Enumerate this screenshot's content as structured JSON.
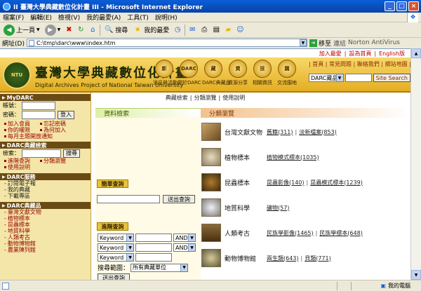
{
  "window": {
    "title": "II 臺灣大學典藏數位化計畫 III - Microsoft Internet Explorer",
    "min": "_",
    "max": "□",
    "close": "×"
  },
  "menu": [
    "檔案(F)",
    "編輯(E)",
    "檢視(V)",
    "我的最愛(A)",
    "工具(T)",
    "說明(H)"
  ],
  "toolbar": {
    "back": "上一頁",
    "search": "搜尋",
    "favorites": "我的最愛"
  },
  "address": {
    "label": "網址(D)",
    "url": "C:\\tmp\\darc\\www\\index.htm",
    "go": "移至",
    "links": "連結",
    "extra": "Norton AntiVirus"
  },
  "status": {
    "zone": "我的電腦"
  },
  "page": {
    "top_links": [
      "加入最愛",
      "設為首頁",
      "English版"
    ],
    "brand_cn": "臺灣大學典藏數位化計畫",
    "brand_en": "Digital Archives Project of National Taiwan University",
    "logo": "NTU",
    "nav": [
      {
        "icon": "新",
        "label": "消息與活動"
      },
      {
        "icon": "DARC",
        "label": "關於DARC"
      },
      {
        "icon": "藏",
        "label": "DARC典藏品"
      },
      {
        "icon": "資",
        "label": "資源分享"
      },
      {
        "icon": "技",
        "label": "相關資訊"
      },
      {
        "icon": "園",
        "label": "交流園地"
      }
    ],
    "right_links": "| 首頁 | 常見問題 | 聯絡我們 | 網站地圖 |",
    "search": {
      "select": "DARC藏品",
      "button": "Site Search"
    },
    "subnav": [
      "典藏檢索",
      "分類瀏覽",
      "使用說明"
    ]
  },
  "sidebar": {
    "mydarc": {
      "title": "MyDARC",
      "account": "帳號：",
      "password": "密碼：",
      "login": "登入"
    },
    "mydarc_links": [
      "加入會員",
      "忘記密碼",
      "你的權限",
      "為何加入",
      "每月主題開放通知"
    ],
    "search": {
      "title": "DARC典藏檢索",
      "label": "檢索：",
      "button": "搜尋"
    },
    "search_links": [
      "進階查詢",
      "分類瀏覽",
      "使用說明"
    ],
    "service": {
      "title": "DARC服務",
      "items": [
        "訂閱電子報",
        "我的典藏",
        "下載專區"
      ]
    },
    "collection": {
      "title": "DARC典藏品",
      "items": [
        "臺灣文獻文物",
        "植物標本",
        "昆蟲標本",
        "地質科學",
        "人類考古",
        "動物博物館",
        "農業陳列館"
      ]
    }
  },
  "query": {
    "tab": "資料檢索",
    "simple": {
      "title": "簡單查詢",
      "button": "送出查詢"
    },
    "advanced": {
      "title": "進階查詢",
      "fields": [
        {
          "field": "Keyword",
          "op": "AND"
        },
        {
          "field": "Keyword",
          "op": "AND"
        },
        {
          "field": "Keyword",
          "op": ""
        }
      ],
      "scope_label": "搜尋範圍：",
      "scope_value": "所有典藏單位",
      "button": "送出查詢"
    }
  },
  "categories": {
    "tab": "分類瀏覽",
    "rows": [
      {
        "name": "台灣文獻文物",
        "links": [
          "舊籍(311)",
          "淡新檔案(853)"
        ]
      },
      {
        "name": "植物標本",
        "links": [
          "植物模式標本(1035)"
        ]
      },
      {
        "name": "昆蟲標本",
        "links": [
          "昆蟲影像(140)",
          "昆蟲模式標本(1239)"
        ]
      },
      {
        "name": "地質科學",
        "links": [
          "礦物(57)"
        ]
      },
      {
        "name": "人類考古",
        "links": [
          "民族學影像(1465)",
          "民族學標本(648)"
        ]
      },
      {
        "name": "動物博物館",
        "links": [
          "兩生類(643)",
          "貝類(771)"
        ]
      }
    ]
  }
}
